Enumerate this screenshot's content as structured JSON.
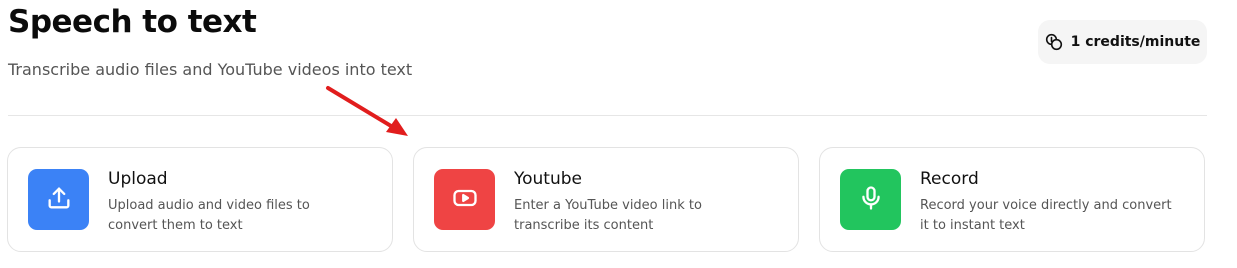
{
  "header": {
    "title": "Speech to text",
    "subtitle": "Transcribe audio files and YouTube videos into text"
  },
  "credits": {
    "label": "1 credits/minute",
    "icon": "coins-icon"
  },
  "cards": [
    {
      "title": "Upload",
      "description": "Upload audio and video files to convert them to text",
      "icon": "upload-icon",
      "color": "#3b82f6"
    },
    {
      "title": "Youtube",
      "description": "Enter a YouTube video link to transcribe its content",
      "icon": "youtube-icon",
      "color": "#ef4444"
    },
    {
      "title": "Record",
      "description": "Record your voice directly and convert it to instant text",
      "icon": "microphone-icon",
      "color": "#22c55e"
    }
  ],
  "annotation": {
    "color": "#e11d1d"
  }
}
